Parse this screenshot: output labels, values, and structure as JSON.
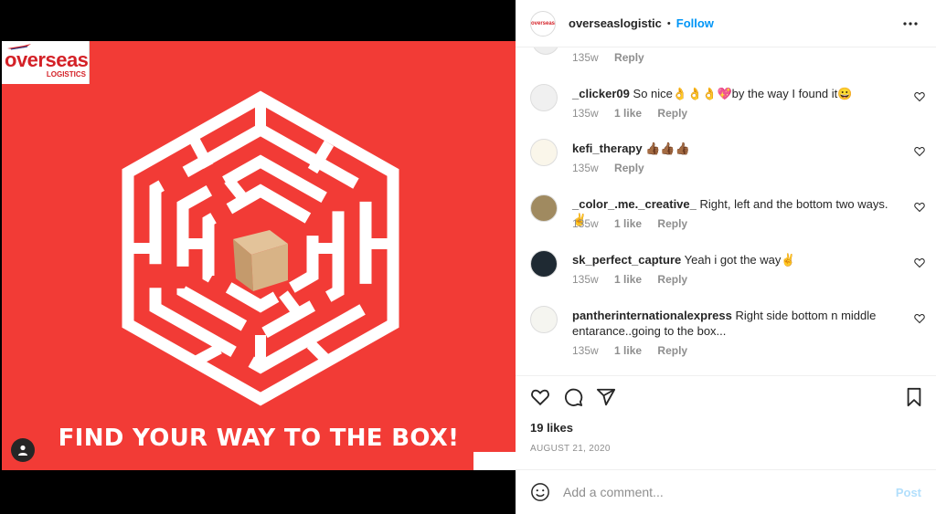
{
  "post": {
    "logo_main": "overseas",
    "logo_sub": "LOGISTICS",
    "caption": "FIND YOUR WAY TO THE BOX!"
  },
  "header": {
    "avatar_text": "overseas",
    "username": "overseaslogistic",
    "separator": "•",
    "follow_label": "Follow"
  },
  "first_comment": {
    "time": "135w",
    "reply": "Reply"
  },
  "comments": [
    {
      "username": "_clicker09",
      "text": "So nice👌👌👌💖by the way I found it😀",
      "time": "135w",
      "likes": "1 like",
      "reply": "Reply"
    },
    {
      "username": "kefi_therapy",
      "text": "👍🏾👍🏾👍🏾",
      "time": "135w",
      "likes": "",
      "reply": "Reply"
    },
    {
      "username": "_color_.me._creative_",
      "text": "Right, left and the bottom two ways.✌",
      "time": "135w",
      "likes": "1 like",
      "reply": "Reply"
    },
    {
      "username": "sk_perfect_capture",
      "text": "Yeah i got the way✌",
      "time": "135w",
      "likes": "1 like",
      "reply": "Reply"
    },
    {
      "username": "pantherinternationalexpress",
      "text": "Right side bottom n middle entarance..going to the box...",
      "time": "135w",
      "likes": "1 like",
      "reply": "Reply"
    }
  ],
  "footer": {
    "likes": "19 likes",
    "date": "AUGUST 21, 2020",
    "comment_placeholder": "Add a comment...",
    "post_label": "Post"
  },
  "colors": {
    "accent": "#0095f6",
    "post_red": "#f23b36"
  }
}
